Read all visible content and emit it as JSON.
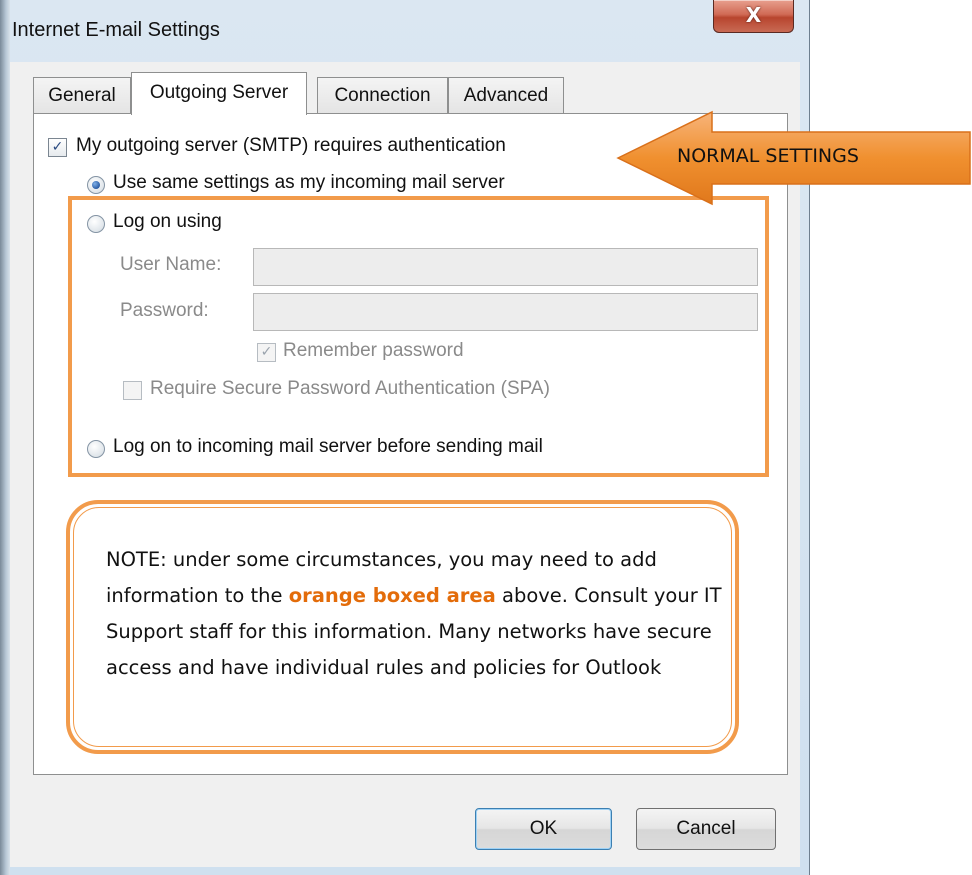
{
  "window": {
    "title": "Internet E-mail Settings",
    "close_glyph": "X"
  },
  "tabs": [
    {
      "label": "General",
      "active": false
    },
    {
      "label": "Outgoing Server",
      "active": true
    },
    {
      "label": "Connection",
      "active": false
    },
    {
      "label": "Advanced",
      "active": false
    }
  ],
  "outgoing": {
    "requires_auth_label": "My outgoing server (SMTP) requires authentication",
    "requires_auth_checked": true,
    "use_same_label": "Use same settings as my incoming mail server",
    "log_on_using_label": "Log on using",
    "user_name_label": "User Name:",
    "user_name_value": "",
    "password_label": "Password:",
    "password_value": "",
    "remember_password_label": "Remember password",
    "remember_password_checked": true,
    "spa_label": "Require Secure Password Authentication (SPA)",
    "spa_checked": false,
    "log_on_incoming_label": "Log on to incoming mail server before sending mail",
    "selected_option": "use_same"
  },
  "annotations": {
    "arrow_label": "NORMAL SETTINGS",
    "note_before": "NOTE: under some circumstances, you may need to add information to the ",
    "note_highlight": "orange boxed area",
    "note_after": " above. Consult your IT Support staff for this information. Many networks have secure access and have individual rules and policies for Outlook",
    "accent_color": "#f29b4b"
  },
  "buttons": {
    "ok": "OK",
    "cancel": "Cancel"
  }
}
